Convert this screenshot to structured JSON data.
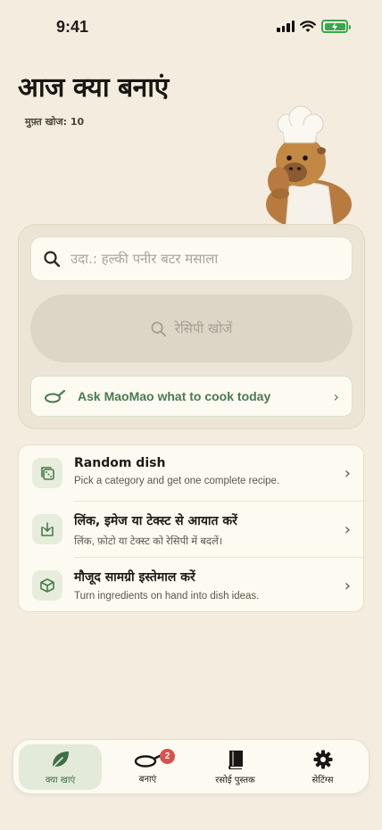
{
  "status": {
    "time": "9:41"
  },
  "header": {
    "title": "आज क्या बनाएं",
    "quota": "मुफ़्त खोज: 10"
  },
  "search": {
    "placeholder": "उदा.: हल्की पनीर बटर मसाला",
    "button_label": "रेसिपी खोजें",
    "ask_label": "Ask MaoMao what to cook today"
  },
  "options": [
    {
      "title": "Random dish",
      "subtitle": "Pick a category and get one complete recipe.",
      "icon": "dice-icon"
    },
    {
      "title": "लिंक, इमेज या टेक्स्ट से आयात करें",
      "subtitle": "लिंक, फ़ोटो या टेक्स्ट को रेसिपी में बदलें।",
      "icon": "import-icon"
    },
    {
      "title": "मौजूद सामग्री इस्तेमाल करें",
      "subtitle": "Turn ingredients on hand into dish ideas.",
      "icon": "box-icon"
    }
  ],
  "tabs": [
    {
      "label": "क्या खाएं",
      "icon": "leaf-icon",
      "active": true
    },
    {
      "label": "बनाएं",
      "icon": "pan-icon",
      "badge": "2"
    },
    {
      "label": "रसोई पुस्तक",
      "icon": "book-icon"
    },
    {
      "label": "सेटिंग्स",
      "icon": "gear-icon"
    }
  ],
  "colors": {
    "background": "#f4ecdf",
    "accent": "#4a7a50",
    "badge": "#d8524a"
  }
}
